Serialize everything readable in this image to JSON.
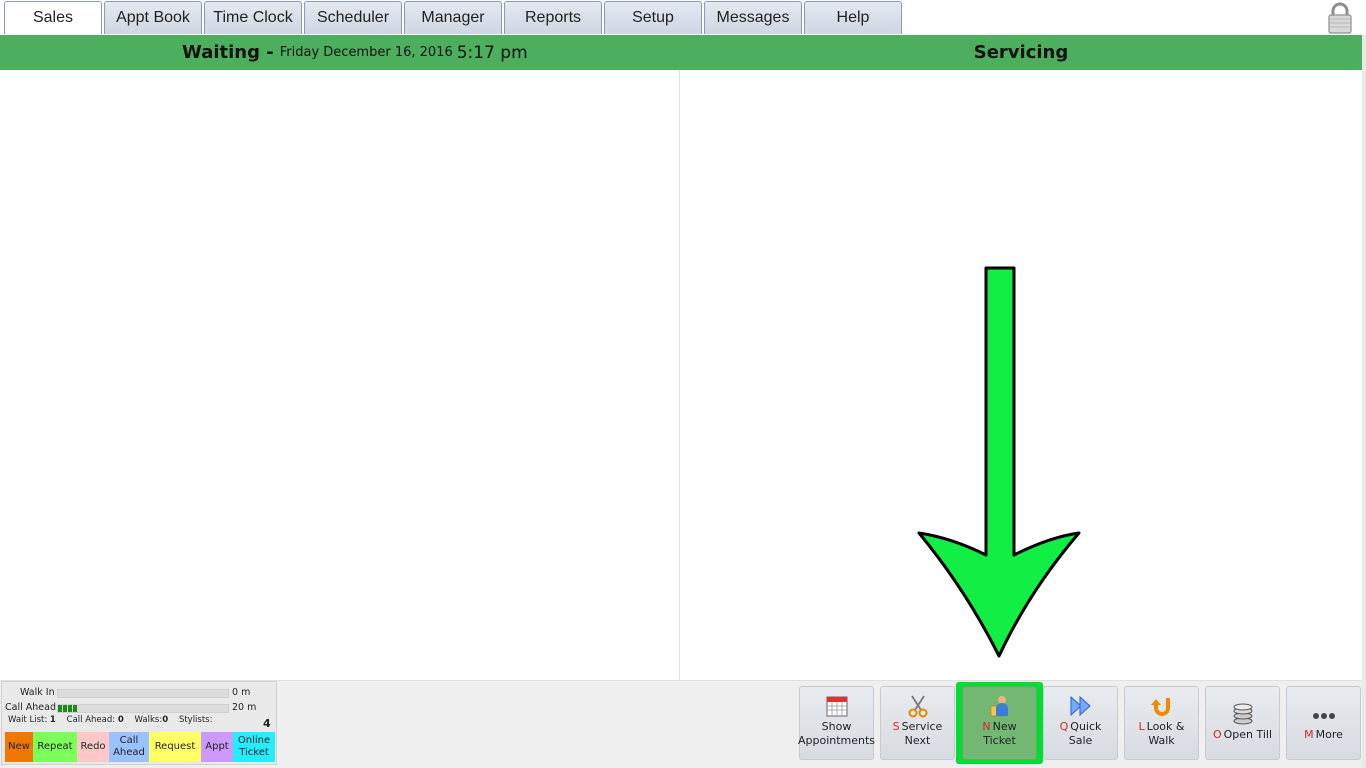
{
  "tabs": [
    {
      "label": "Sales",
      "active": true
    },
    {
      "label": "Appt Book"
    },
    {
      "label": "Time Clock"
    },
    {
      "label": "Scheduler"
    },
    {
      "label": "Manager"
    },
    {
      "label": "Reports"
    },
    {
      "label": "Setup"
    },
    {
      "label": "Messages"
    },
    {
      "label": "Help"
    }
  ],
  "header": {
    "waiting_title": "Waiting -",
    "date": "Friday December 16, 2016",
    "time": "5:17 pm",
    "servicing_title": "Servicing"
  },
  "stats": {
    "walk_in": {
      "label": "Walk In",
      "value": "0 m",
      "level": 0
    },
    "call_ahead": {
      "label": "Call Ahead",
      "value": "20 m",
      "segments": 4
    },
    "wait_list_label": "Wait List:",
    "wait_list": "1",
    "call_ahead_label": "Call Ahead:",
    "call_ahead_count": "0",
    "walks_label": "Walks:",
    "walks": "0",
    "stylists_label": "Stylists:",
    "stylists": "4"
  },
  "legend": [
    {
      "label": "New",
      "color": "#f07800"
    },
    {
      "label": "Repeat",
      "color": "#7cff5a"
    },
    {
      "label": "Redo",
      "color": "#ffc8c8"
    },
    {
      "label": "Call\nAhead",
      "color": "#99c2ff"
    },
    {
      "label": "Request",
      "color": "#ffff66"
    },
    {
      "label": "Appt",
      "color": "#cc99ff"
    },
    {
      "label": "Online\nTicket",
      "color": "#22eeff"
    }
  ],
  "actions": [
    {
      "key": "",
      "line1": "Show",
      "line2": "Appointments",
      "icon": "calendar-icon"
    },
    {
      "key": "S",
      "line1": "Service",
      "line2": "Next",
      "icon": "scissors-icon"
    },
    {
      "key": "N",
      "line1": "New",
      "line2": "Ticket",
      "icon": "person-ticket-icon"
    },
    {
      "key": "Q",
      "line1": "Quick",
      "line2": "Sale",
      "icon": "fast-forward-icon"
    },
    {
      "key": "L",
      "line1": "Look &",
      "line2": "Walk",
      "icon": "u-turn-arrow-icon"
    },
    {
      "key": "O",
      "line1": "Open Till",
      "line2": "",
      "icon": "coin-stack-icon"
    },
    {
      "key": "M",
      "line1": "More",
      "line2": "",
      "icon": "more-dots-icon"
    }
  ],
  "colors": {
    "header_green": "#4caf5e",
    "highlight": "#00dd33",
    "arrow_green": "#11ee44"
  }
}
